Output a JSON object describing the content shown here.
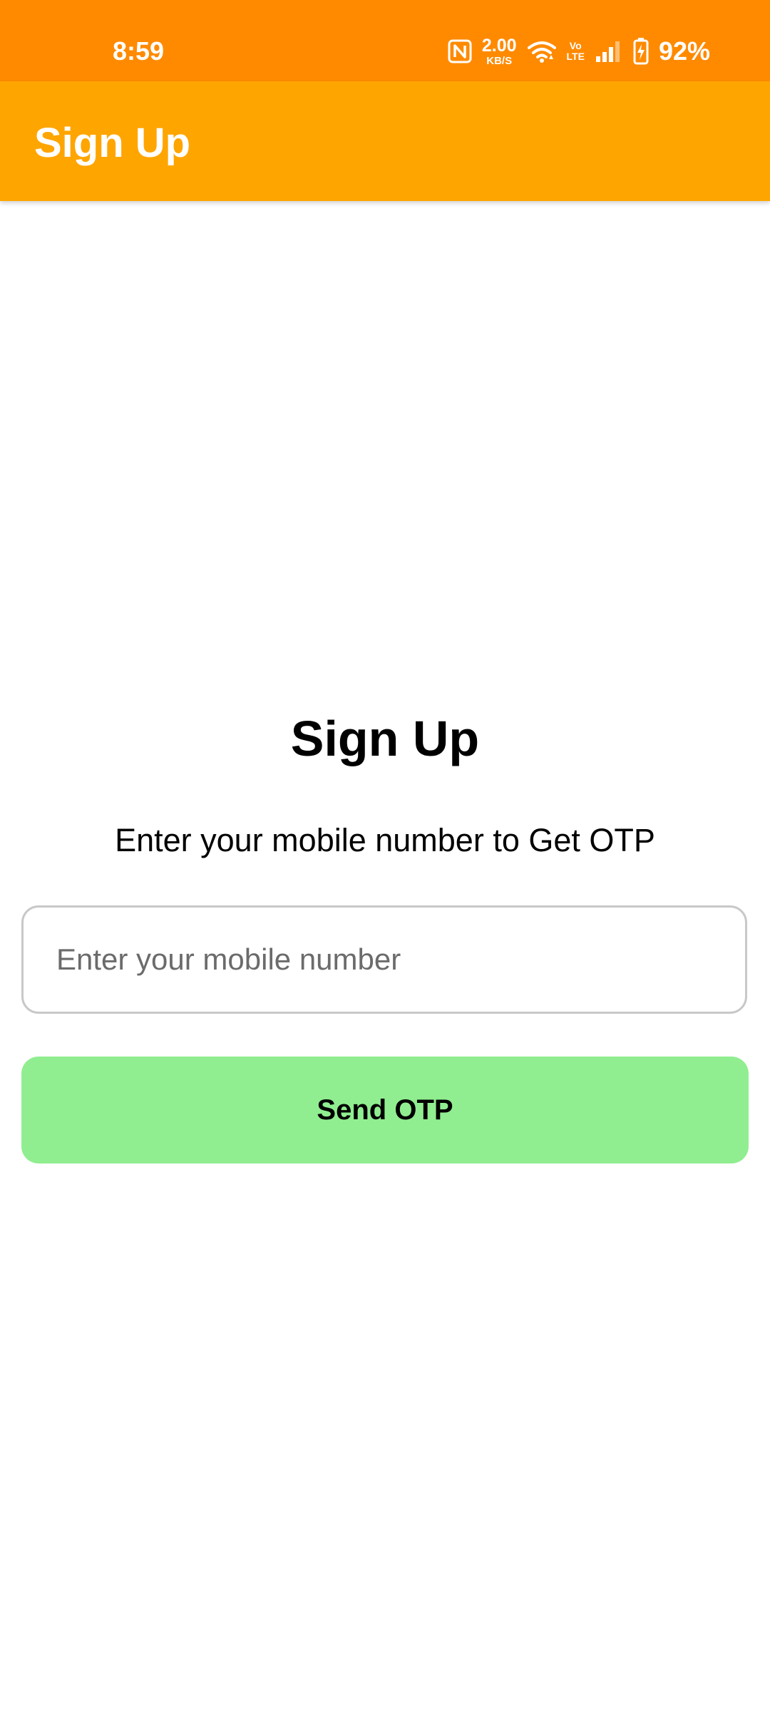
{
  "status_bar": {
    "time": "8:59",
    "network_speed_value": "2.00",
    "network_speed_unit": "KB/S",
    "volte_top": "Vo",
    "volte_bottom": "LTE",
    "battery_percent": "92%",
    "icons": [
      "nfc-icon",
      "wifi-icon",
      "volte-icon",
      "signal-icon",
      "battery-charging-icon"
    ],
    "background_color": "#FF8A00"
  },
  "app_bar": {
    "title": "Sign Up",
    "background_color": "#FFA500"
  },
  "main": {
    "heading": "Sign Up",
    "subtitle": "Enter your mobile number to Get OTP",
    "mobile_input": {
      "value": "",
      "placeholder": "Enter your mobile number"
    },
    "send_button_label": "Send OTP",
    "send_button_color": "#90EE90"
  }
}
